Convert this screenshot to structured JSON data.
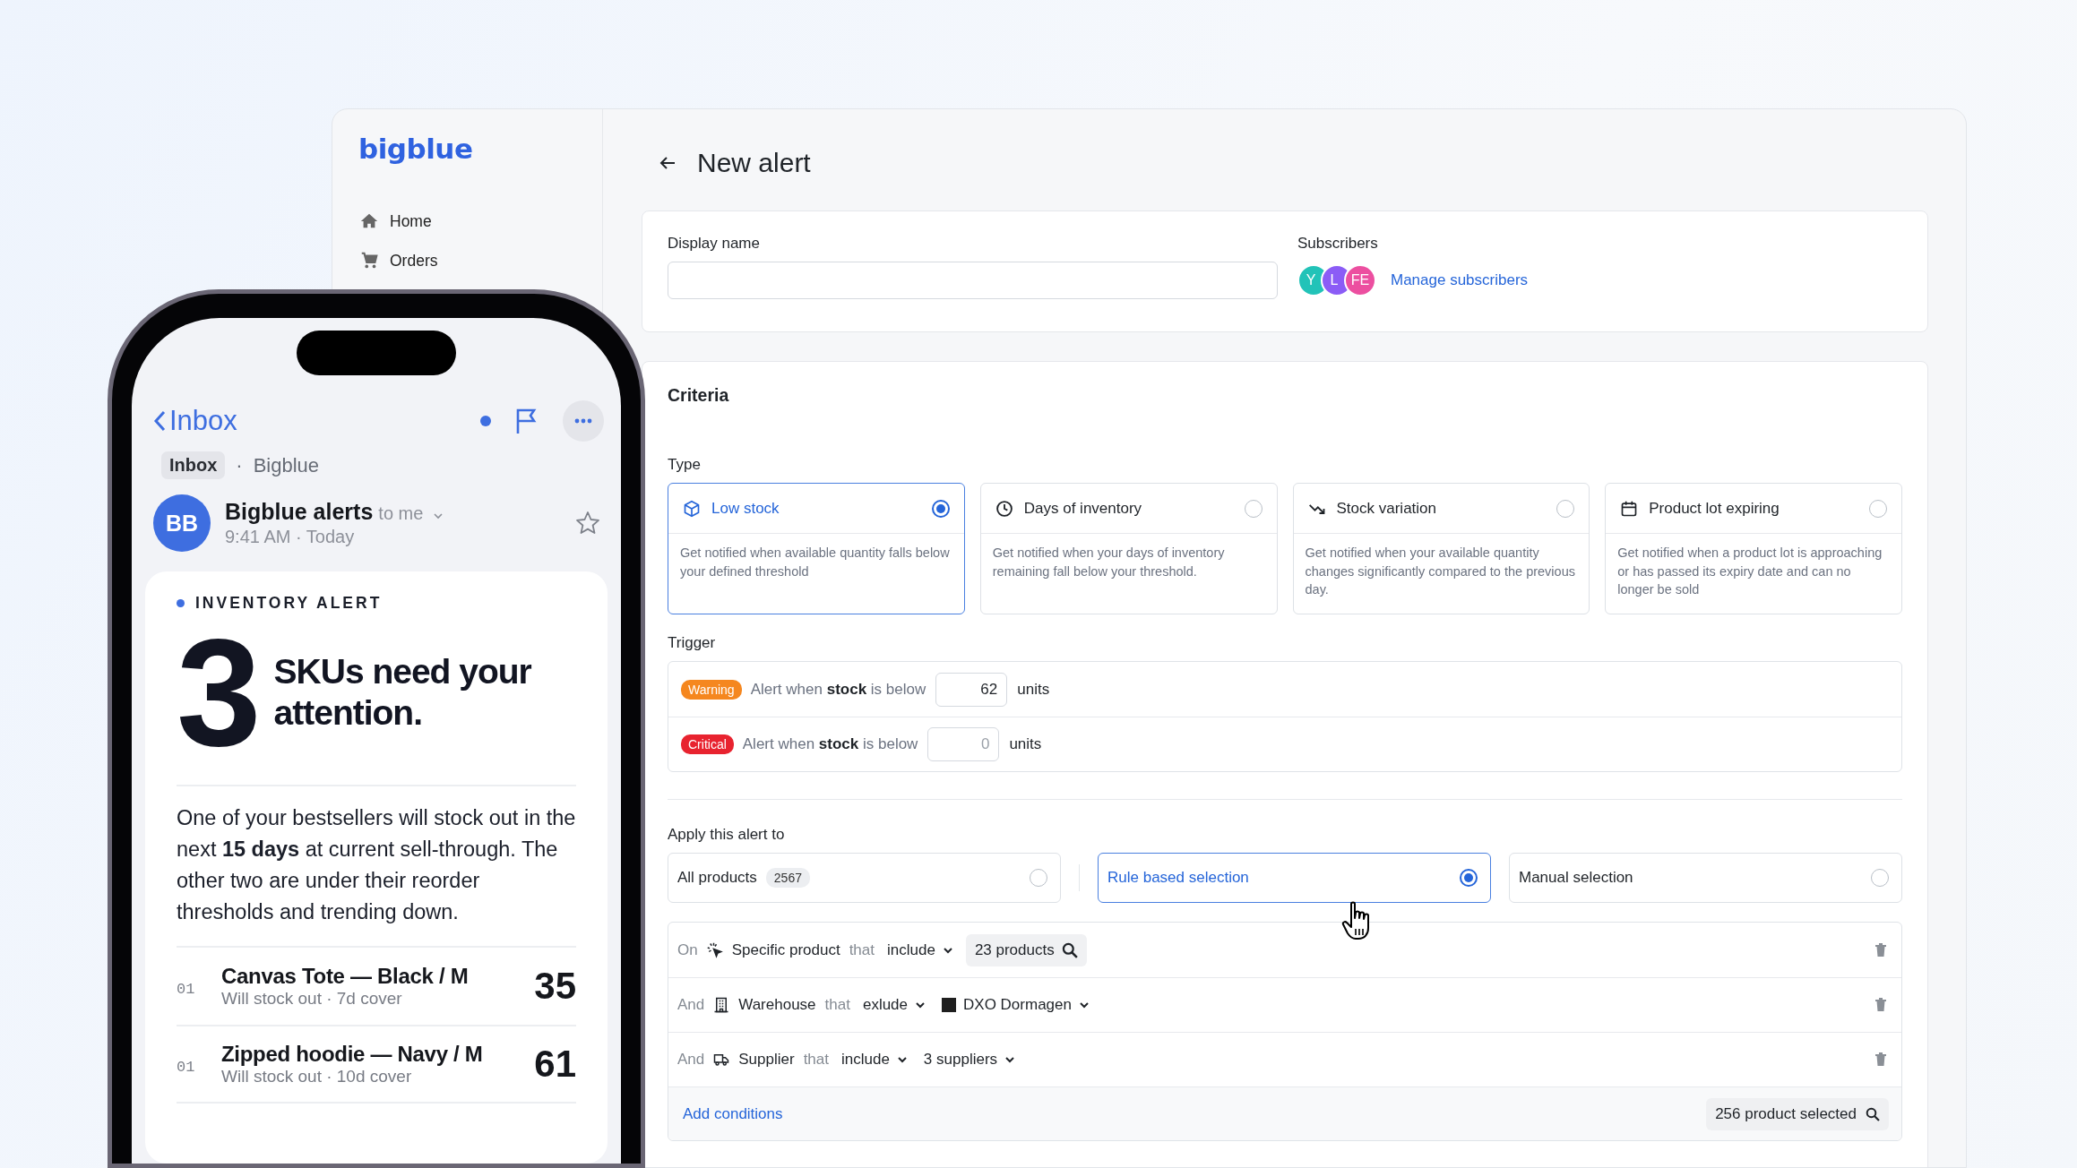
{
  "app": {
    "logo": "bigblue",
    "nav": [
      {
        "label": "Home"
      },
      {
        "label": "Orders"
      }
    ],
    "header": {
      "title": "New alert"
    },
    "general": {
      "display_name_label": "Display name",
      "subscribers_label": "Subscribers",
      "subscribers": [
        {
          "initials": "Y",
          "color": "#22c3b8"
        },
        {
          "initials": "L",
          "color": "#8b5cf6"
        },
        {
          "initials": "FE",
          "color": "#ec4fa0"
        }
      ],
      "manage_link": "Manage subscribers"
    },
    "criteria": {
      "title": "Criteria",
      "type_label": "Type",
      "types": [
        {
          "title": "Low stock",
          "description": "Get notified when available quantity falls below your defined threshold",
          "selected": true
        },
        {
          "title": "Days of inventory",
          "description": "Get notified when your days of inventory remaining fall below your threshold.",
          "selected": false
        },
        {
          "title": "Stock variation",
          "description": "Get notified when your available quantity changes significantly compared to the previous day.",
          "selected": false
        },
        {
          "title": "Product lot expiring",
          "description": "Get notified when a product lot is approaching or has passed its expiry date and can no longer be sold",
          "selected": false
        }
      ],
      "trigger_label": "Trigger",
      "triggers": [
        {
          "badge": "Warning",
          "color": "#f5871f",
          "text": "Alert when **stock** is below",
          "value": "62",
          "unit": "units"
        },
        {
          "badge": "Critical",
          "color": "#e8232f",
          "text": "Alert when **stock** is below",
          "placeholder": "0",
          "unit": "units"
        }
      ],
      "apply_label": "Apply this alert to",
      "scopes": [
        {
          "label": "All products",
          "count": "2567",
          "selected": false
        },
        {
          "label": "Rule based selection",
          "selected": true
        },
        {
          "label": "Manual selection",
          "selected": false
        }
      ],
      "conditions": [
        {
          "prefix": "On",
          "field": "Specific product",
          "that": "that",
          "operator": "include",
          "value": "23 products",
          "kind": "search"
        },
        {
          "prefix": "And",
          "field": "Warehouse",
          "that": "that",
          "operator": "exlude",
          "value": "DXO Dormagen",
          "kind": "logo"
        },
        {
          "prefix": "And",
          "field": "Supplier",
          "that": "that",
          "operator": "include",
          "value": "3 suppliers",
          "kind": "dropdown"
        }
      ],
      "add_conditions": "Add conditions",
      "selected_count": "256 product selected"
    }
  },
  "phone": {
    "back": "Inbox",
    "folder_tag": "Inbox",
    "separator": "·",
    "mailbox": "Bigblue",
    "avatar": "BB",
    "sender": "Bigblue alerts",
    "recipient": "to me",
    "time": "9:41 AM · Today",
    "email": {
      "eyebrow": "INVENTORY ALERT",
      "big_number": "3",
      "headline": "SKUs need your attention.",
      "body": "One of your bestsellers will stock out in the next **15 days** at current sell-through. The other two are under their reorder thresholds and trending down.",
      "items": [
        {
          "rank": "01",
          "name": "Canvas Tote — Black / M",
          "detail": "Will stock out · 7d cover",
          "quantity": "35"
        },
        {
          "rank": "01",
          "name": "Zipped hoodie — Navy / M",
          "detail": "Will stock out · 10d cover",
          "quantity": "61"
        }
      ]
    }
  }
}
